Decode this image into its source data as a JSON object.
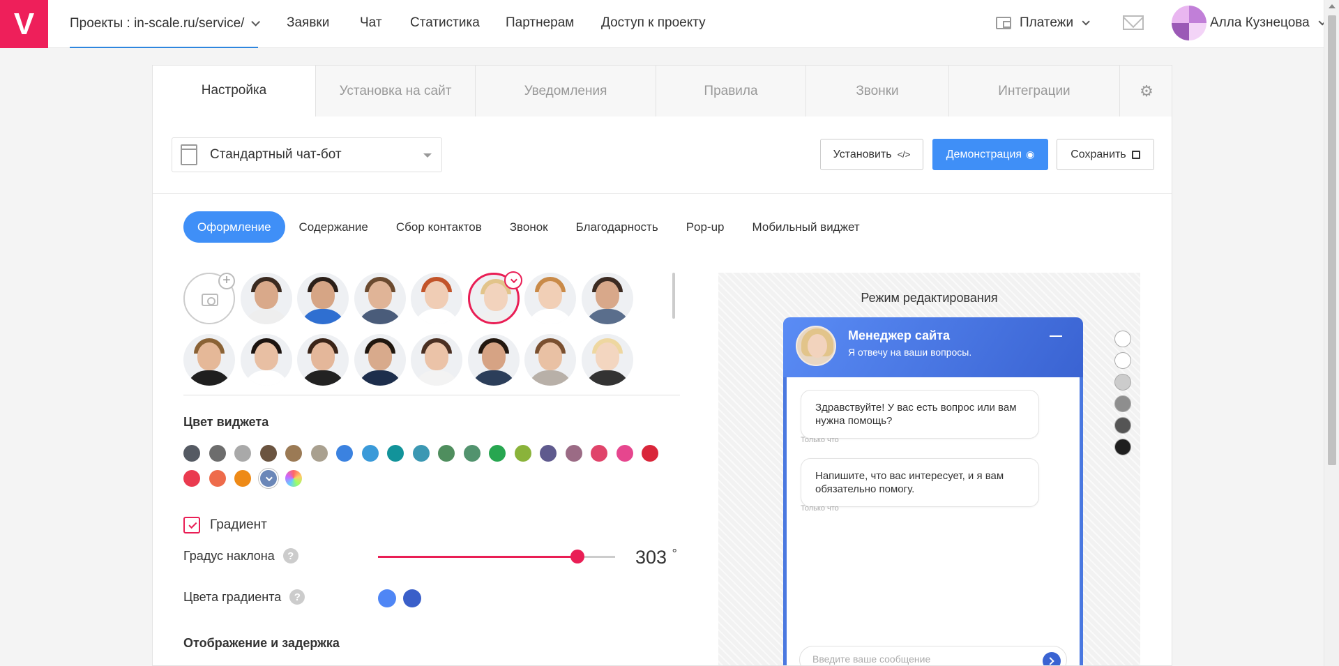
{
  "app": {
    "logo": "V"
  },
  "nav": {
    "project": "Проекты : in-scale.ru/service/",
    "items": [
      "Заявки",
      "Чат",
      "Статистика",
      "Партнерам",
      "Доступ к проекту"
    ],
    "payments": "Платежи",
    "user": "Алла Кузнецова"
  },
  "tabs": [
    {
      "label": "Настройка",
      "active": true
    },
    {
      "label": "Установка на сайт"
    },
    {
      "label": "Уведомления"
    },
    {
      "label": "Правила"
    },
    {
      "label": "Звонки"
    },
    {
      "label": "Интеграции"
    }
  ],
  "template_select": {
    "value": "Стандартный чат-бот"
  },
  "buttons": {
    "install": "Установить",
    "install_icon": "</>",
    "demo": "Демонстрация",
    "save": "Сохранить"
  },
  "subtabs": [
    "Оформление",
    "Содержание",
    "Сбор контактов",
    "Звонок",
    "Благодарность",
    "Pop-up",
    "Мобильный виджет"
  ],
  "avatars": {
    "selected_index": 5,
    "items": [
      {
        "skin": "#d9a98a",
        "hair": "#3a2a20",
        "shirt": "#eeeeee"
      },
      {
        "skin": "#d6a585",
        "hair": "#2b1f18",
        "shirt": "#2f6fd1"
      },
      {
        "skin": "#e0b497",
        "hair": "#6b4a2f",
        "shirt": "#4a5c7a"
      },
      {
        "skin": "#f0cdb5",
        "hair": "#c2542a",
        "shirt": "#ffffff"
      },
      {
        "skin": "#f2d3bd",
        "hair": "#e2c48a",
        "shirt": "#f0f0f0"
      },
      {
        "skin": "#f1cfb6",
        "hair": "#c98a48",
        "shirt": "#ffffff"
      },
      {
        "skin": "#d8a88a",
        "hair": "#3c2b22",
        "shirt": "#5a6e8c"
      },
      {
        "skin": "#e5b898",
        "hair": "#8a6235",
        "shirt": "#1f1f1f"
      },
      {
        "skin": "#e8bfa3",
        "hair": "#1c1410",
        "shirt": "#ffffff"
      },
      {
        "skin": "#e4b79a",
        "hair": "#3a2418",
        "shirt": "#222222"
      },
      {
        "skin": "#d8aa8c",
        "hair": "#20170f",
        "shirt": "#1d2e4c"
      },
      {
        "skin": "#ebc3a8",
        "hair": "#4a2f22",
        "shirt": "#f3f3f3"
      },
      {
        "skin": "#d6a384",
        "hair": "#22170f",
        "shirt": "#2c3e5a"
      },
      {
        "skin": "#e9c1a4",
        "hair": "#7a5030",
        "shirt": "#b8b0a8"
      },
      {
        "skin": "#f3d6c0",
        "hair": "#eed7a0",
        "shirt": "#333333"
      }
    ]
  },
  "widget_color": {
    "title": "Цвет виджета",
    "colors": [
      "#555a63",
      "#6d6d6d",
      "#a9a9a9",
      "#6b5440",
      "#9b7a55",
      "#a9a08f",
      "#3b82e0",
      "#3a9ad9",
      "#12939a",
      "#3b98b3",
      "#4f8e5e",
      "#52936e",
      "#27a650",
      "#8ab33a",
      "#5f5a8e",
      "#9b6b85",
      "#e0446a",
      "#e6468e",
      "#d9263a",
      "#ea3a4f",
      "#ee6b4b",
      "#ee8a17",
      "#6b87b8",
      "rainbow"
    ],
    "selected_index": 22
  },
  "gradient": {
    "label": "Градиент",
    "checked": true,
    "angle_label": "Градус наклона",
    "angle_value": "303",
    "angle_unit": "°",
    "angle_fraction": 0.84,
    "colors_label": "Цвета градиента",
    "colors": [
      "#4f86f5",
      "#3a5fc9"
    ],
    "help_icon": "?"
  },
  "display_section": {
    "title": "Отображение и задержка"
  },
  "preview": {
    "title": "Режим редактирования",
    "chat_name": "Менеджер сайта",
    "chat_sub": "Я отвечу на ваши вопросы.",
    "messages": [
      {
        "text": "Здравствуйте! У вас есть вопрос или вам нужна помощь?",
        "time": "Только что"
      },
      {
        "text": "Напишите, что вас интересует, и я вам обязательно помогу.",
        "time": "Только что"
      }
    ],
    "input_placeholder": "Введите ваше сообщение",
    "side_colors": [
      "#ffffff",
      "#ffffff",
      "#cccccc",
      "#8e8e8e",
      "#555555",
      "#1f1f1f"
    ]
  }
}
